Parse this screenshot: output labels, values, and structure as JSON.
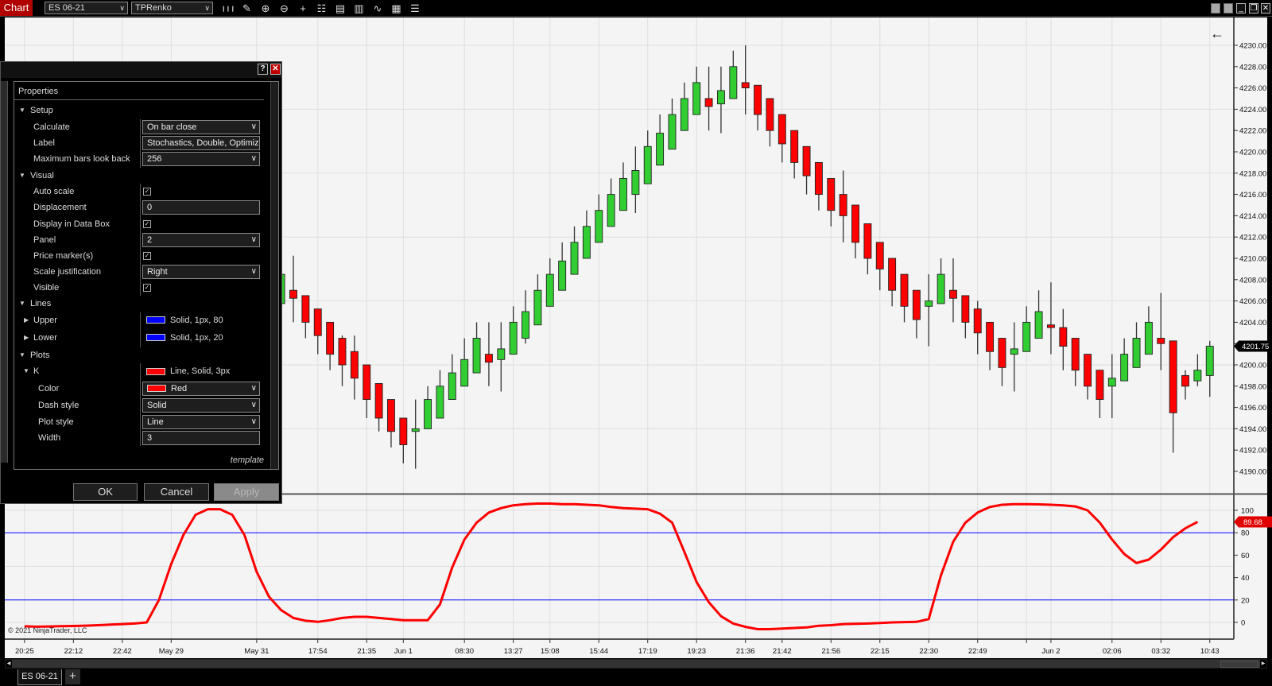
{
  "toolbar": {
    "title": "Chart",
    "instrument": "ES 06-21",
    "bar_type": "TPRenko",
    "icons": [
      "bars-type-icon",
      "pencil-drawing-icon",
      "zoom-in-icon",
      "zoom-out-icon",
      "crosshair-icon",
      "properties-icon",
      "data-box-icon",
      "indicators-icon",
      "strategies-icon",
      "templates-icon",
      "chart-trader-list-icon"
    ]
  },
  "window_controls": [
    "tile-1",
    "tile-2",
    "minimize",
    "restore",
    "close"
  ],
  "dialog": {
    "help": "?",
    "close": "✕",
    "header": "Properties",
    "rows": [
      {
        "type": "section",
        "label": "Setup"
      },
      {
        "type": "select",
        "label": "Calculate",
        "value": "On bar close"
      },
      {
        "type": "text",
        "label": "Label",
        "value": "Stochastics, Double, Optimized"
      },
      {
        "type": "select",
        "label": "Maximum bars look back",
        "value": "256"
      },
      {
        "type": "section",
        "label": "Visual"
      },
      {
        "type": "check",
        "label": "Auto scale",
        "value": "✓"
      },
      {
        "type": "text",
        "label": "Displacement",
        "value": "0"
      },
      {
        "type": "check",
        "label": "Display in Data Box",
        "value": "✓"
      },
      {
        "type": "select",
        "label": "Panel",
        "value": "2"
      },
      {
        "type": "check",
        "label": "Price marker(s)",
        "value": "✓"
      },
      {
        "type": "select",
        "label": "Scale justification",
        "value": "Right"
      },
      {
        "type": "check",
        "label": "Visible",
        "value": "✓"
      },
      {
        "type": "section",
        "label": "Lines"
      },
      {
        "type": "line",
        "label": "Upper",
        "value": "Solid, 1px, 80",
        "color": "#0000ff"
      },
      {
        "type": "line",
        "label": "Lower",
        "value": "Solid, 1px, 20",
        "color": "#0000ff"
      },
      {
        "type": "section",
        "label": "Plots"
      },
      {
        "type": "plot",
        "label": "K",
        "value": "Line, Solid, 3px",
        "color": "#ff0000"
      },
      {
        "type": "colorselect",
        "label": "Color",
        "value": "Red",
        "color": "#ff0000"
      },
      {
        "type": "select",
        "label": "Dash style",
        "value": "Solid",
        "sub": true
      },
      {
        "type": "select",
        "label": "Plot style",
        "value": "Line",
        "sub": true
      },
      {
        "type": "text",
        "label": "Width",
        "value": "3",
        "sub": true
      }
    ],
    "template_link": "template",
    "ok": "OK",
    "cancel": "Cancel",
    "apply": "Apply"
  },
  "chart_data": {
    "type": "candlestick",
    "instrument": "ES 06-21",
    "colors": {
      "up": "#32cd32",
      "down": "#ff0000",
      "stoch": "#ff0000",
      "levels": "#0000ff",
      "background": "#f4f4f4"
    },
    "price_axis": {
      "min": 4188,
      "max": 4231,
      "ticks": [
        4190,
        4192,
        4194,
        4196,
        4198,
        4200,
        4202,
        4204,
        4206,
        4208,
        4210,
        4212,
        4214,
        4216,
        4218,
        4220,
        4222,
        4224,
        4226,
        4228,
        4230
      ],
      "gridlines": [
        4194,
        4200,
        4206,
        4212,
        4218,
        4224,
        4230
      ]
    },
    "last_price": "4201.75",
    "first_candle_bar": -1,
    "candles_ohlc": [
      [
        4205.75,
        4209,
        4205.5,
        4208.5
      ],
      [
        4207,
        4210.25,
        4204,
        4206.25
      ],
      [
        4206.5,
        4206.5,
        4202.5,
        4204
      ],
      [
        4205.25,
        4205.25,
        4201,
        4202.75
      ],
      [
        4204,
        4204,
        4199.5,
        4201
      ],
      [
        4202.5,
        4202.75,
        4198,
        4200
      ],
      [
        4201.25,
        4202.75,
        4196.75,
        4198.75
      ],
      [
        4200,
        4200,
        4195,
        4196.75
      ],
      [
        4198.25,
        4198.25,
        4193.75,
        4195
      ],
      [
        4196.75,
        4196.75,
        4192.25,
        4193.75
      ],
      [
        4195,
        4195,
        4190.75,
        4192.5
      ],
      [
        4193.75,
        4196.75,
        4190.25,
        4194
      ],
      [
        4194,
        4198,
        4194,
        4196.75
      ],
      [
        4195,
        4199.5,
        4195,
        4198
      ],
      [
        4196.75,
        4201,
        4196.75,
        4199.25
      ],
      [
        4198,
        4202.5,
        4198,
        4200.5
      ],
      [
        4199.25,
        4204,
        4199.25,
        4202.5
      ],
      [
        4201,
        4204,
        4198,
        4200.25
      ],
      [
        4200.5,
        4204,
        4197.5,
        4201.5
      ],
      [
        4201,
        4205.5,
        4201,
        4204
      ],
      [
        4202.5,
        4207,
        4202,
        4205
      ],
      [
        4203.75,
        4208.5,
        4203.75,
        4207
      ],
      [
        4205.5,
        4210,
        4205.5,
        4208.5
      ],
      [
        4207,
        4211.5,
        4207,
        4209.75
      ],
      [
        4208.5,
        4213,
        4208.5,
        4211.5
      ],
      [
        4210,
        4214.5,
        4210,
        4213
      ],
      [
        4211.5,
        4216,
        4211.5,
        4214.5
      ],
      [
        4213,
        4217.5,
        4213,
        4216
      ],
      [
        4214.5,
        4219,
        4214.5,
        4217.5
      ],
      [
        4216,
        4220.5,
        4214.25,
        4218.25
      ],
      [
        4217,
        4222,
        4217,
        4220.5
      ],
      [
        4218.75,
        4223.5,
        4218.75,
        4221.75
      ],
      [
        4220.25,
        4225,
        4220.25,
        4223.5
      ],
      [
        4222,
        4226.5,
        4222,
        4225
      ],
      [
        4223.5,
        4228,
        4223.5,
        4226.5
      ],
      [
        4225,
        4228,
        4222,
        4224.25
      ],
      [
        4224.5,
        4228,
        4221.75,
        4225.75
      ],
      [
        4225,
        4229.5,
        4225,
        4228
      ],
      [
        4226.5,
        4230,
        4223.5,
        4226
      ],
      [
        4226.25,
        4226.25,
        4222,
        4223.5
      ],
      [
        4225,
        4225,
        4220.5,
        4222
      ],
      [
        4223.5,
        4223.5,
        4219,
        4220.75
      ],
      [
        4222,
        4222,
        4217.5,
        4219
      ],
      [
        4220.5,
        4220.5,
        4216,
        4217.75
      ],
      [
        4219,
        4219,
        4214.5,
        4216
      ],
      [
        4217.5,
        4217.5,
        4213,
        4214.5
      ],
      [
        4216,
        4218.25,
        4211.5,
        4214
      ],
      [
        4215,
        4215,
        4210,
        4211.5
      ],
      [
        4213.25,
        4213.25,
        4208.5,
        4210
      ],
      [
        4211.5,
        4211.5,
        4207,
        4209
      ],
      [
        4210,
        4210,
        4205.5,
        4207
      ],
      [
        4208.5,
        4208.5,
        4204,
        4205.5
      ],
      [
        4207,
        4207,
        4202.5,
        4204.25
      ],
      [
        4205.5,
        4208.5,
        4201.75,
        4206
      ],
      [
        4205.75,
        4210,
        4205.75,
        4208.5
      ],
      [
        4207,
        4210,
        4204,
        4206.25
      ],
      [
        4206.5,
        4206.5,
        4202.5,
        4204
      ],
      [
        4205.25,
        4206,
        4201,
        4203
      ],
      [
        4204,
        4204,
        4199.5,
        4201.25
      ],
      [
        4202.5,
        4202.5,
        4198,
        4199.75
      ],
      [
        4201,
        4204,
        4197.5,
        4201.5
      ],
      [
        4201.25,
        4205.5,
        4201.25,
        4204
      ],
      [
        4202.5,
        4207,
        4202.5,
        4205
      ],
      [
        4203.75,
        4207.75,
        4201,
        4203.5
      ],
      [
        4203.5,
        4205.25,
        4199.5,
        4201.75
      ],
      [
        4202.5,
        4202.5,
        4198,
        4199.5
      ],
      [
        4201,
        4201,
        4196.75,
        4198
      ],
      [
        4199.5,
        4199.5,
        4195,
        4196.75
      ],
      [
        4198,
        4201,
        4195,
        4198.75
      ],
      [
        4198.5,
        4202.5,
        4198.5,
        4201
      ],
      [
        4199.75,
        4204,
        4199.75,
        4202.5
      ],
      [
        4201,
        4205.5,
        4201,
        4204
      ],
      [
        4202.5,
        4206.75,
        4199.5,
        4202
      ],
      [
        4202.25,
        4202.25,
        4191.75,
        4195.5
      ],
      [
        4199,
        4199.5,
        4196.75,
        4198
      ],
      [
        4198.5,
        4201,
        4198,
        4199.5
      ],
      [
        4199,
        4202.25,
        4197,
        4201.75
      ]
    ],
    "stochastics": {
      "name": "K",
      "first_bar": -22,
      "upper": 80,
      "lower": 20,
      "last_value": "89.68",
      "axis_ticks": [
        0,
        20,
        40,
        60,
        80,
        100
      ],
      "values": [
        -3.5,
        -3.8,
        -3.6,
        -3.4,
        -3.2,
        -2.9,
        -2.5,
        -2,
        -1.5,
        -1,
        0,
        20,
        52,
        78,
        96,
        101,
        101,
        96,
        78,
        45,
        23,
        11,
        4,
        1.5,
        0.5,
        2,
        4,
        5,
        5,
        4,
        3,
        2,
        2,
        2,
        16,
        49,
        74,
        89,
        98,
        102,
        104.5,
        105.5,
        106,
        106,
        105.5,
        105.5,
        105,
        104.5,
        103,
        102,
        101.5,
        101,
        97,
        89,
        63,
        36,
        18,
        5.5,
        -1,
        -4,
        -6,
        -6,
        -5.5,
        -5,
        -4.5,
        -3,
        -2.5,
        -1.5,
        -1.2,
        -1,
        -0.5,
        0,
        0.3,
        0.5,
        3,
        42,
        72,
        89,
        98,
        103,
        105,
        105.5,
        105.5,
        105.3,
        105,
        104.5,
        103.5,
        100,
        89,
        74,
        61,
        53,
        56,
        65,
        76,
        84,
        89.68
      ]
    },
    "time_axis": [
      {
        "label": "20:25",
        "bar": -22
      },
      {
        "label": "22:12",
        "bar": -18
      },
      {
        "label": "22:42",
        "bar": -14
      },
      {
        "label": "May 29",
        "bar": -10
      },
      {
        "label": "May 31",
        "bar": -3
      },
      {
        "label": "17:54",
        "bar": 2
      },
      {
        "label": "21:35",
        "bar": 6
      },
      {
        "label": "Jun 1",
        "bar": 9
      },
      {
        "label": "08:30",
        "bar": 14
      },
      {
        "label": "13:27",
        "bar": 18
      },
      {
        "label": "15:08",
        "bar": 21
      },
      {
        "label": "15:44",
        "bar": 25
      },
      {
        "label": "17:19",
        "bar": 29
      },
      {
        "label": "19:23",
        "bar": 33
      },
      {
        "label": "21:36",
        "bar": 37
      },
      {
        "label": "21:42",
        "bar": 40
      },
      {
        "label": "21:56",
        "bar": 44
      },
      {
        "label": "22:15",
        "bar": 48
      },
      {
        "label": "22:30",
        "bar": 52
      },
      {
        "label": "22:49",
        "bar": 56
      },
      {
        "label": "",
        "bar": 60
      },
      {
        "label": "Jun 2",
        "bar": 62
      },
      {
        "label": "02:06",
        "bar": 67
      },
      {
        "label": "03:32",
        "bar": 71
      },
      {
        "label": "10:43",
        "bar": 75
      }
    ]
  },
  "copyright": "© 2021 NinjaTrader, LLC",
  "tabs": {
    "active": "ES 06-21",
    "add": "+"
  }
}
